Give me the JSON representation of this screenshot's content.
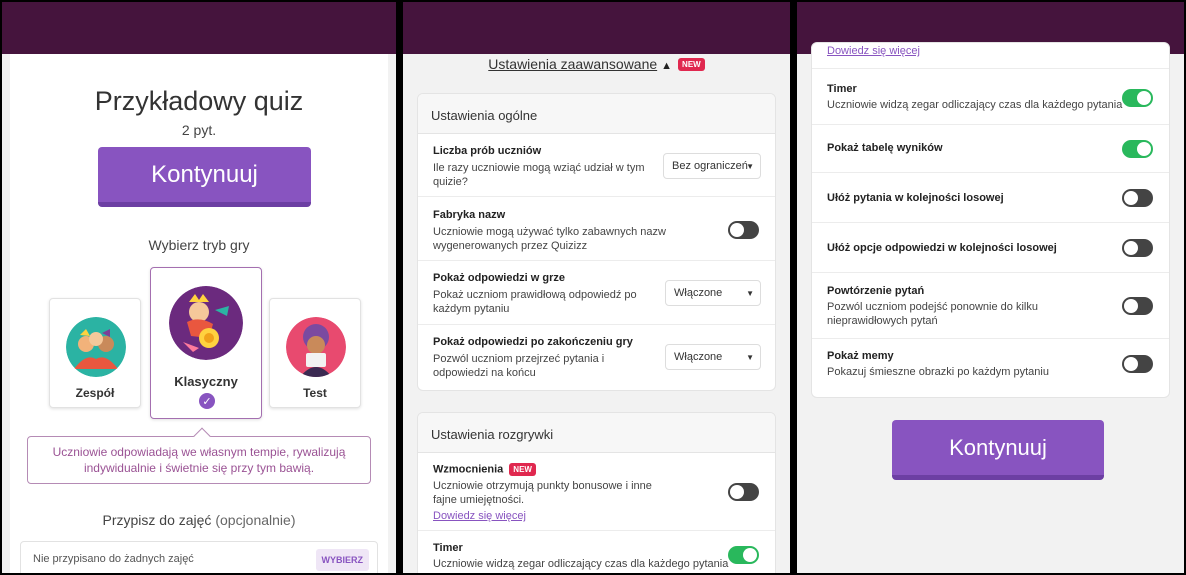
{
  "panel1": {
    "quiz_title": "Przykładowy quiz",
    "question_count": "2 pyt.",
    "continue_label": "Kontynuuj",
    "mode_heading": "Wybierz tryb gry",
    "modes": [
      {
        "label": "Zespół",
        "selected": false,
        "icon": "team-illustration-icon"
      },
      {
        "label": "Klasyczny",
        "selected": true,
        "icon": "classic-illustration-icon"
      },
      {
        "label": "Test",
        "selected": false,
        "icon": "test-illustration-icon"
      }
    ],
    "mode_description": "Uczniowie odpowiadają we własnym tempie, rywalizują indywidualnie i świetnie się przy tym bawią.",
    "assign_heading": "Przypisz do zajęć",
    "assign_optional": "(opcjonalnie)",
    "assign_placeholder": "Nie przypisano do żadnych zajęć",
    "assign_button": "WYBIERZ"
  },
  "panel2": {
    "advanced_link": "Ustawienia zaawansowane",
    "new_badge": "NEW",
    "general_section": {
      "title": "Ustawienia ogólne",
      "rows": [
        {
          "title": "Liczba prób uczniów",
          "desc": "Ile razy uczniowie mogą wziąć udział w tym quizie?",
          "control": "select",
          "value": "Bez ograniczeń"
        },
        {
          "title": "Fabryka nazw",
          "desc": "Uczniowie mogą używać tylko zabawnych nazw wygenerowanych przez Quizizz",
          "control": "toggle",
          "on": false
        },
        {
          "title": "Pokaż odpowiedzi w grze",
          "desc": "Pokaż uczniom prawidłową odpowiedź po każdym pytaniu",
          "control": "select",
          "value": "Włączone"
        },
        {
          "title": "Pokaż odpowiedzi po zakończeniu gry",
          "desc": "Pozwól uczniom przejrzeć pytania i odpowiedzi na końcu",
          "control": "select",
          "value": "Włączone"
        }
      ]
    },
    "gameplay_section": {
      "title": "Ustawienia rozgrywki",
      "rows": [
        {
          "title": "Wzmocnienia",
          "badge": "NEW",
          "desc": "Uczniowie otrzymują punkty bonusowe i inne fajne umiejętności.",
          "link": "Dowiedz się więcej",
          "control": "toggle",
          "on": false
        },
        {
          "title": "Timer",
          "desc": "Uczniowie widzą zegar odliczający czas dla każdego pytania",
          "control": "toggle",
          "on": true
        }
      ]
    }
  },
  "panel3": {
    "top_link": "Dowiedz się więcej",
    "rows": [
      {
        "title": "Timer",
        "desc": "Uczniowie widzą zegar odliczający czas dla każdego pytania",
        "on": true
      },
      {
        "title": "Pokaż tabelę wyników",
        "desc": "",
        "on": true
      },
      {
        "title": "Ułóż pytania w kolejności losowej",
        "desc": "",
        "on": false
      },
      {
        "title": "Ułóż opcje odpowiedzi w kolejności losowej",
        "desc": "",
        "on": false
      },
      {
        "title": "Powtórzenie pytań",
        "desc": "Pozwól uczniom podejść ponownie do kilku nieprawidłowych pytań",
        "on": false
      },
      {
        "title": "Pokaż memy",
        "desc": "Pokazuj śmieszne obrazki po każdym pytaniu",
        "on": false
      }
    ],
    "continue_label": "Kontynuuj"
  },
  "colors": {
    "header": "#45143d",
    "primary": "#8854c0",
    "toggle_on": "#29b85c",
    "toggle_off": "#444444",
    "badge": "#e0284f"
  }
}
